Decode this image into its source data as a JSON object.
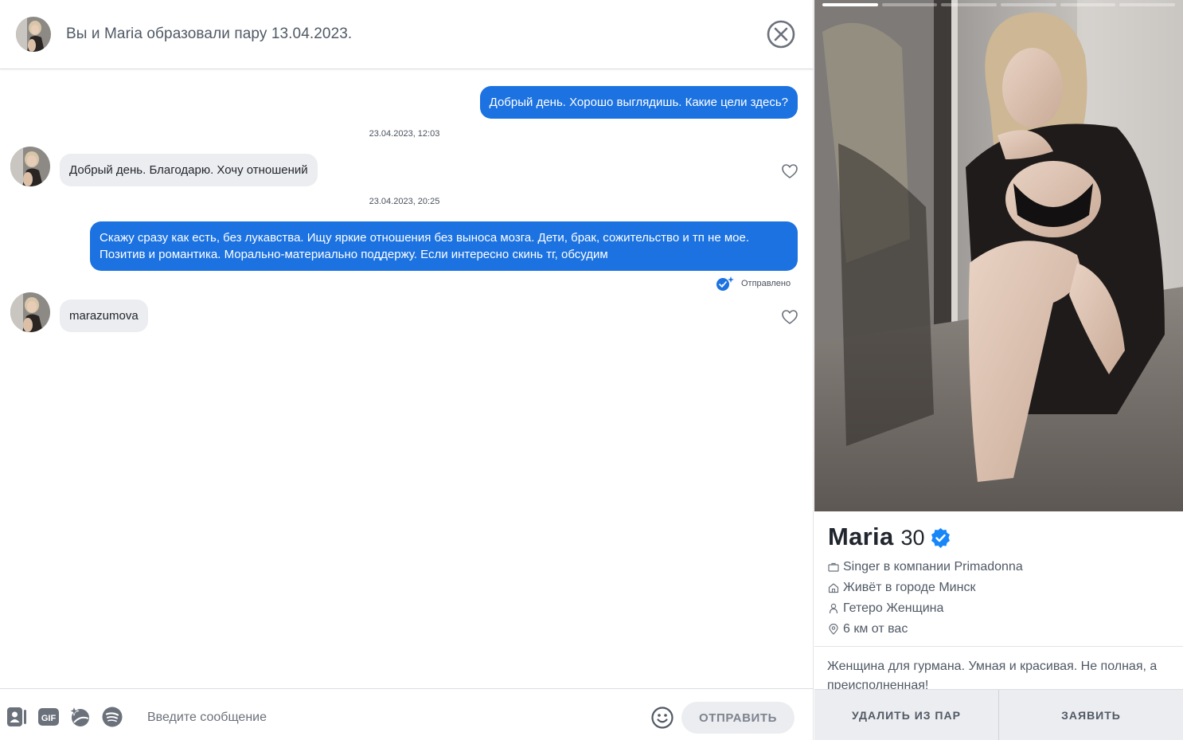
{
  "header": {
    "title": "Вы и Maria образовали пару 13.04.2023."
  },
  "messages": [
    {
      "direction": "out",
      "text": "Добрый день. Хорошо выглядишь. Какие цели здесь?"
    },
    {
      "timestamp": "23.04.2023, 12:03"
    },
    {
      "direction": "in",
      "text": "Добрый день. Благодарю. Хочу отношений"
    },
    {
      "timestamp": "23.04.2023, 20:25"
    },
    {
      "direction": "out",
      "line1": "Скажу сразу как есть, без лукавства. Ищу яркие отношения без выноса мозга. Дети, брак, сожительство и тп не мое.",
      "line2": "Позитив и романтика. Морально-материально поддержу. Если интересно скинь тг, обсудим",
      "status": "Отправлено"
    },
    {
      "direction": "in",
      "text": "marazumova"
    }
  ],
  "composer": {
    "placeholder": "Введите сообщение",
    "send_label": "ОТПРАВИТЬ",
    "tools": [
      "contact-card-icon",
      "gif-icon",
      "sticker-sparkle-icon",
      "spotify-icon"
    ]
  },
  "profile": {
    "name": "Maria",
    "age": "30",
    "verified": true,
    "job": "Singer в компании Primadonna",
    "city": "Живёт в городе Минск",
    "orientation": "Гетеро Женщина",
    "distance": "6 км от вас",
    "bio": "Женщина для гурмана. Умная и красивая. Не полная, а преисполненная!",
    "photo_count": 6,
    "photo_active": 1
  },
  "actions": {
    "unmatch_label": "УДАЛИТЬ ИЗ ПАР",
    "report_label": "ЗАЯВИТЬ"
  },
  "colors": {
    "outgoing_bubble": "#1b72e0",
    "incoming_bubble": "#ecedf0",
    "verified_badge": "#1786f9"
  }
}
